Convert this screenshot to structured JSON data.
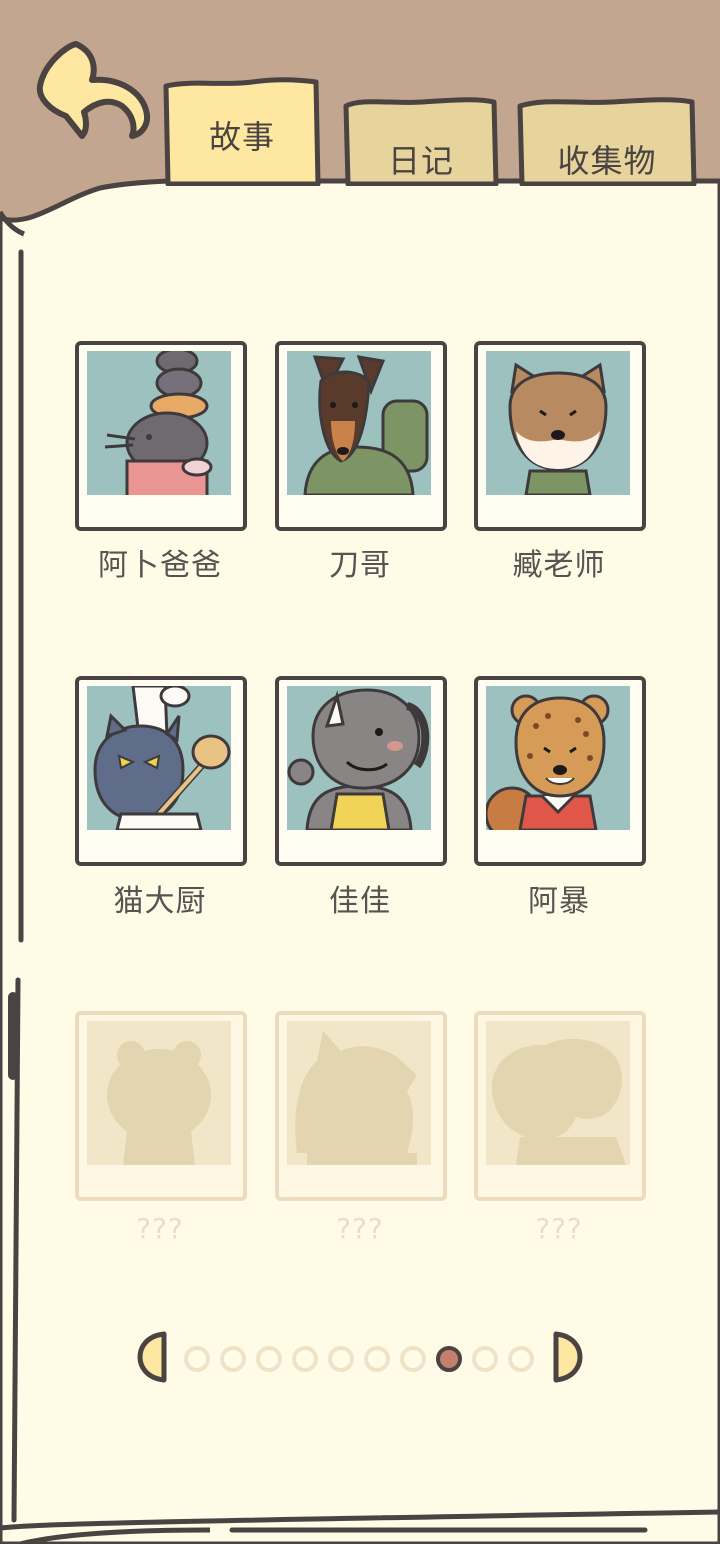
{
  "tabs": [
    {
      "id": "story",
      "label": "故事",
      "active": true
    },
    {
      "id": "diary",
      "label": "日记",
      "active": false
    },
    {
      "id": "collect",
      "label": "收集物",
      "active": false
    }
  ],
  "characters": [
    {
      "name": "阿卜爸爸",
      "icon": "rat-family-portrait",
      "unlocked": true
    },
    {
      "name": "刀哥",
      "icon": "doberman-portrait",
      "unlocked": true
    },
    {
      "name": "臧老师",
      "icon": "shiba-dog-portrait",
      "unlocked": true
    },
    {
      "name": "猫大厨",
      "icon": "chef-cat-portrait",
      "unlocked": true
    },
    {
      "name": "佳佳",
      "icon": "rhino-portrait",
      "unlocked": true
    },
    {
      "name": "阿暴",
      "icon": "cheetah-portrait",
      "unlocked": true
    },
    {
      "name": "???",
      "icon": "bear-silhouette",
      "unlocked": false
    },
    {
      "name": "???",
      "icon": "animal-silhouette",
      "unlocked": false
    },
    {
      "name": "???",
      "icon": "animal-silhouette",
      "unlocked": false
    }
  ],
  "pagination": {
    "total_pages": 10,
    "current_page": 8
  },
  "colors": {
    "background": "#c3a690",
    "page": "#fffbe6",
    "outline": "#4a4342",
    "tab_active": "#fde7a1",
    "tab_inactive": "#e6d49c",
    "photo_bg": "#9cc1bf",
    "locked": "#ecdcbd",
    "active_dot": "#c47f6e"
  }
}
